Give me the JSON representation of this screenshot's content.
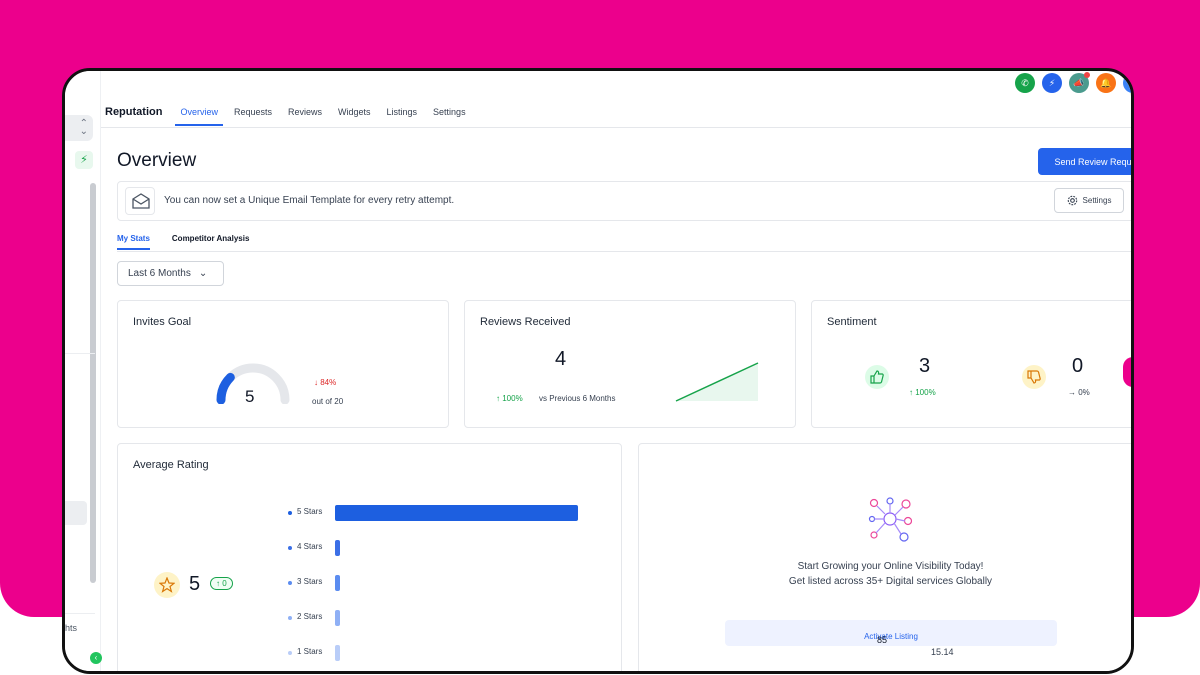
{
  "nav": {
    "brand": "Reputation",
    "tabs": [
      "Overview",
      "Requests",
      "Reviews",
      "Widgets",
      "Listings",
      "Settings"
    ],
    "active_tab": "Overview"
  },
  "top_icons": [
    {
      "name": "phone-icon",
      "color": "#16a34a",
      "glyph": "✆"
    },
    {
      "name": "quick-actions-icon",
      "color": "#2563eb",
      "glyph": "⚡"
    },
    {
      "name": "megaphone-icon",
      "color": "#4b9b8e",
      "glyph": "📣"
    },
    {
      "name": "bell-icon",
      "color": "#f97316",
      "glyph": "🔔"
    },
    {
      "name": "help-icon",
      "color": "#3b82f6",
      "glyph": "?"
    }
  ],
  "page_title": "Overview",
  "send_button_label": "Send Review Requ",
  "banner": {
    "message": "You can now set a Unique Email Template for every retry attempt.",
    "settings_label": "Settings"
  },
  "subtabs": [
    "My Stats",
    "Competitor Analysis"
  ],
  "range_label": "Last 6 Months",
  "sidebar": {
    "partial_text": "hts"
  },
  "invites_goal": {
    "title": "Invites Goal",
    "value": "5",
    "goal_fraction": 0.25,
    "change": "84%",
    "out_of": "out of 20"
  },
  "reviews_received": {
    "title": "Reviews Received",
    "count": "4",
    "change": "100%",
    "compare": "vs Previous 6 Months"
  },
  "sentiment": {
    "title": "Sentiment",
    "positive": "3",
    "positive_change": "100%",
    "negative": "0",
    "negative_change": "0%"
  },
  "average_rating": {
    "title": "Average Rating",
    "value": "5",
    "change": "0",
    "bars": [
      {
        "label": "5 Stars",
        "fraction": 1.0,
        "color": "#1d5fe0"
      },
      {
        "label": "4 Stars",
        "fraction": 0.02,
        "color": "#3b6fe6"
      },
      {
        "label": "3 Stars",
        "fraction": 0.02,
        "color": "#5b8cf0"
      },
      {
        "label": "2 Stars",
        "fraction": 0.02,
        "color": "#8fb0f5"
      },
      {
        "label": "1 Stars",
        "fraction": 0.02,
        "color": "#b9cdf8"
      }
    ]
  },
  "listings": {
    "headline_1": "Start Growing your Online Visibility Today!",
    "headline_2": "Get listed across 35+ Digital services Globally",
    "button_label": "Activate Listing",
    "stray_value_1": "85",
    "stray_value_2": "15.14"
  }
}
